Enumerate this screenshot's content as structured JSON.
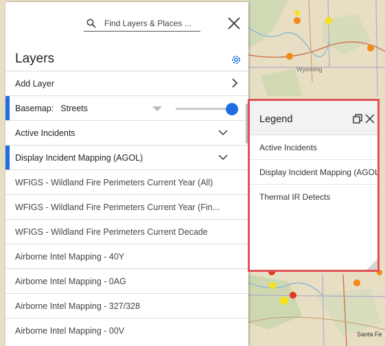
{
  "search": {
    "placeholder": "Find Layers & Places ..."
  },
  "panel": {
    "title": "Layers"
  },
  "layers": {
    "add_layer": "Add Layer",
    "basemap_label": "Basemap:",
    "basemap_value": "Streets",
    "basemap_opacity": 1.0,
    "items": [
      "Active Incidents",
      "Display Incident Mapping (AGOL)",
      "WFIGS - Wildland Fire Perimeters Current Year (All)",
      "WFIGS - Wildland Fire Perimeters Current Year (Fin...",
      "WFIGS - Wildland Fire Perimeters Current Decade",
      "Airborne Intel Mapping - 40Y",
      "Airborne Intel Mapping - 0AG",
      "Airborne Intel Mapping - 327/328",
      "Airborne Intel Mapping - 00V"
    ]
  },
  "legend": {
    "title": "Legend",
    "items": [
      "Active Incidents",
      "Display Incident Mapping (AGOL)",
      "Thermal IR Detects"
    ]
  },
  "map": {
    "labels": [
      "Wyoming",
      "Santa Fe"
    ],
    "colors": {
      "incident_orange": "#f08a12",
      "incident_yellow": "#f7e11a",
      "incident_red": "#e03a1e",
      "accent_blue": "#1f6fe0"
    }
  }
}
